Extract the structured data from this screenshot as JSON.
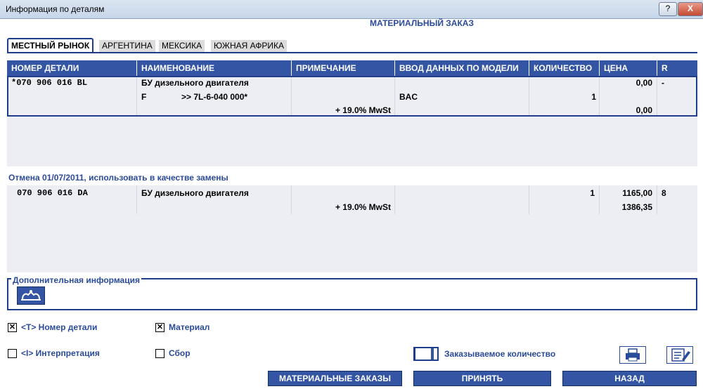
{
  "window": {
    "title": "Информация по деталям",
    "help_label": "?",
    "close_label": "X",
    "header": "МАТЕРИАЛЬНЫЙ ЗАКАЗ"
  },
  "tabs": [
    "МЕСТНЫЙ РЫНОК",
    "АРГЕНТИНА",
    "МЕКСИКА",
    "ЮЖНАЯ АФРИКА"
  ],
  "columns": [
    "НОМЕР ДЕТАЛИ",
    "НАИМЕНОВАНИЕ",
    "ПРИМЕЧАНИЕ",
    "ВВОД ДАННЫХ ПО МОДЕЛИ",
    "КОЛИЧЕСТВО",
    "ЦЕНА",
    "R"
  ],
  "row1": {
    "part_number": "*070 906 016 BL",
    "name": "БУ дизельного двигателя",
    "name_line2_prefix": "F",
    "name_line2_ref": ">> 7L-6-040 000*",
    "note": "+ 19.0% MwSt",
    "model_entry": "BAC",
    "quantity": "1",
    "price": "0,00",
    "price_tax": "0,00",
    "r": "-"
  },
  "replacement_note": "Отмена 01/07/2011, использовать в качестве замены",
  "row2": {
    "part_number": "070 906 016 DA",
    "name": "БУ дизельного двигателя",
    "note": "+ 19.0% MwSt",
    "quantity": "1",
    "price": "1165,00",
    "price_tax": "1386,35",
    "r": "8"
  },
  "additional_info_label": "Дополнительная информация",
  "checkboxes": {
    "part_number": {
      "label": "<T> Номер детали",
      "checked": true,
      "mark": "✕"
    },
    "material": {
      "label": "Материал",
      "checked": true,
      "mark": "✕"
    },
    "interpretation": {
      "label": "<I> Интерпретация",
      "checked": false,
      "mark": ""
    },
    "assembly": {
      "label": "Сбор",
      "checked": false,
      "mark": ""
    }
  },
  "order_qty_label": "Заказываемое количество",
  "order_qty_value": "",
  "buttons": {
    "material_orders": "МАТЕРИАЛЬНЫЕ ЗАКАЗЫ",
    "accept": "ПРИНЯТЬ",
    "back": "НАЗАД"
  },
  "icons": [
    "engine-icon",
    "printer-icon",
    "edit-document-icon"
  ],
  "colors": {
    "accent": "#3355a3",
    "text_blue": "#2a4a9a",
    "panel": "#eceef3"
  }
}
